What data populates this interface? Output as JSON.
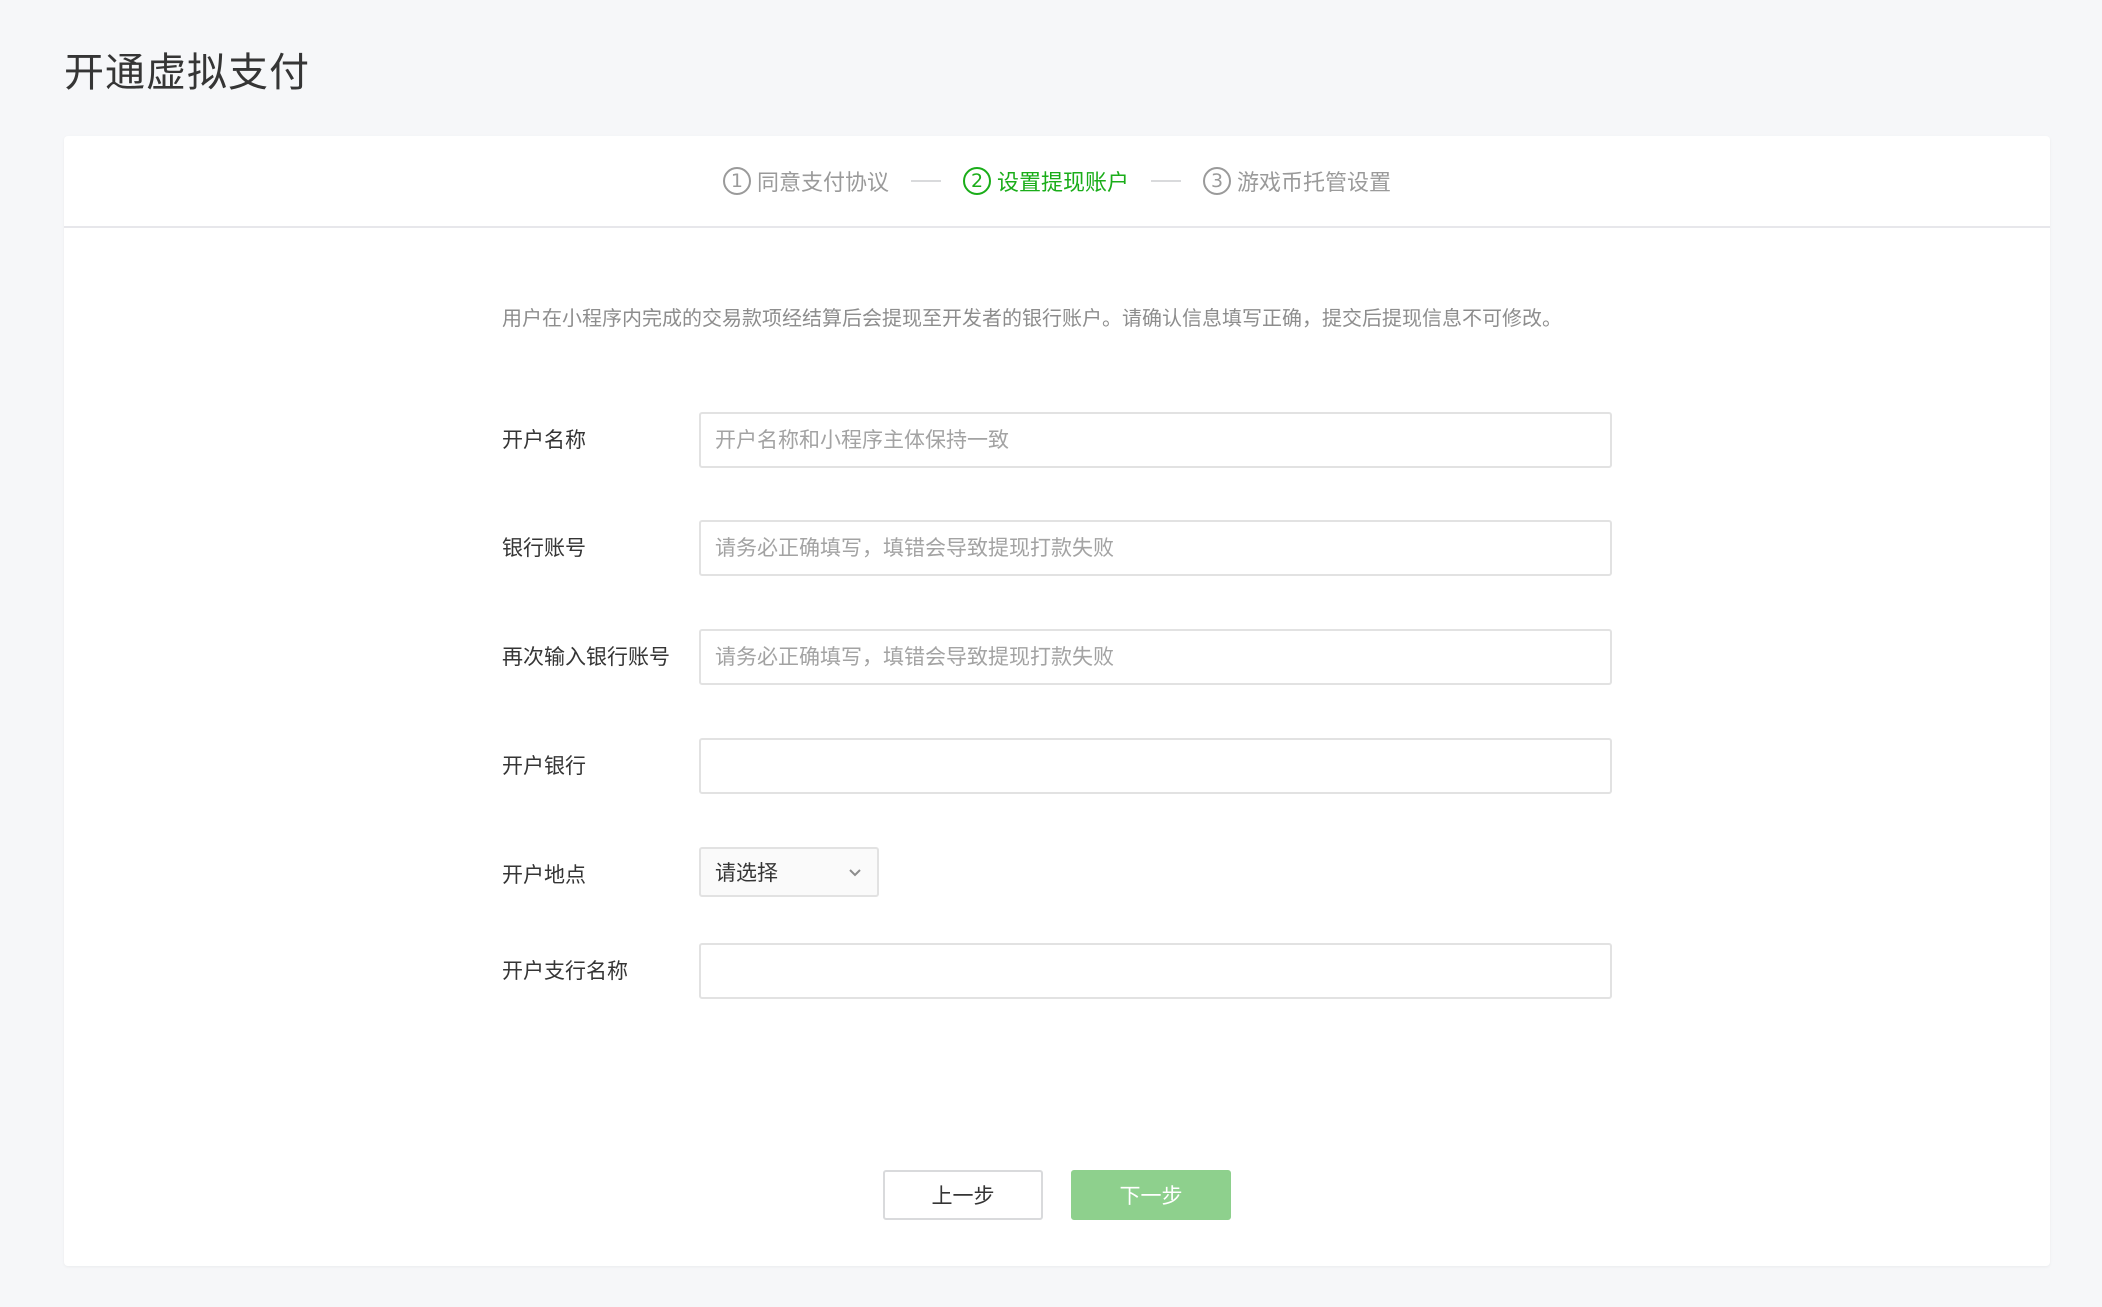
{
  "page": {
    "title": "开通虚拟支付"
  },
  "steps": [
    {
      "num": "1",
      "label": "同意支付协议",
      "state": "done"
    },
    {
      "num": "2",
      "label": "设置提现账户",
      "state": "active"
    },
    {
      "num": "3",
      "label": "游戏币托管设置",
      "state": "pending"
    }
  ],
  "notice": "用户在小程序内完成的交易款项经结算后会提现至开发者的银行账户。请确认信息填写正确，提交后提现信息不可修改。",
  "form": {
    "account_name": {
      "label": "开户名称",
      "value": "",
      "placeholder": "开户名称和小程序主体保持一致"
    },
    "bank_account": {
      "label": "银行账号",
      "value": "",
      "placeholder": "请务必正确填写，填错会导致提现打款失败"
    },
    "bank_account_confirm": {
      "label": "再次输入银行账号",
      "value": "",
      "placeholder": "请务必正确填写，填错会导致提现打款失败"
    },
    "bank": {
      "label": "开户银行",
      "value": "",
      "placeholder": ""
    },
    "location": {
      "label": "开户地点",
      "selected": "请选择"
    },
    "branch_name": {
      "label": "开户支行名称",
      "value": "",
      "placeholder": ""
    }
  },
  "buttons": {
    "prev": "上一步",
    "next": "下一步"
  },
  "colors": {
    "accent": "#1aad19",
    "next_button_disabled": "#8ed08d"
  },
  "icons": {
    "location_select": "chevron-down-icon"
  }
}
